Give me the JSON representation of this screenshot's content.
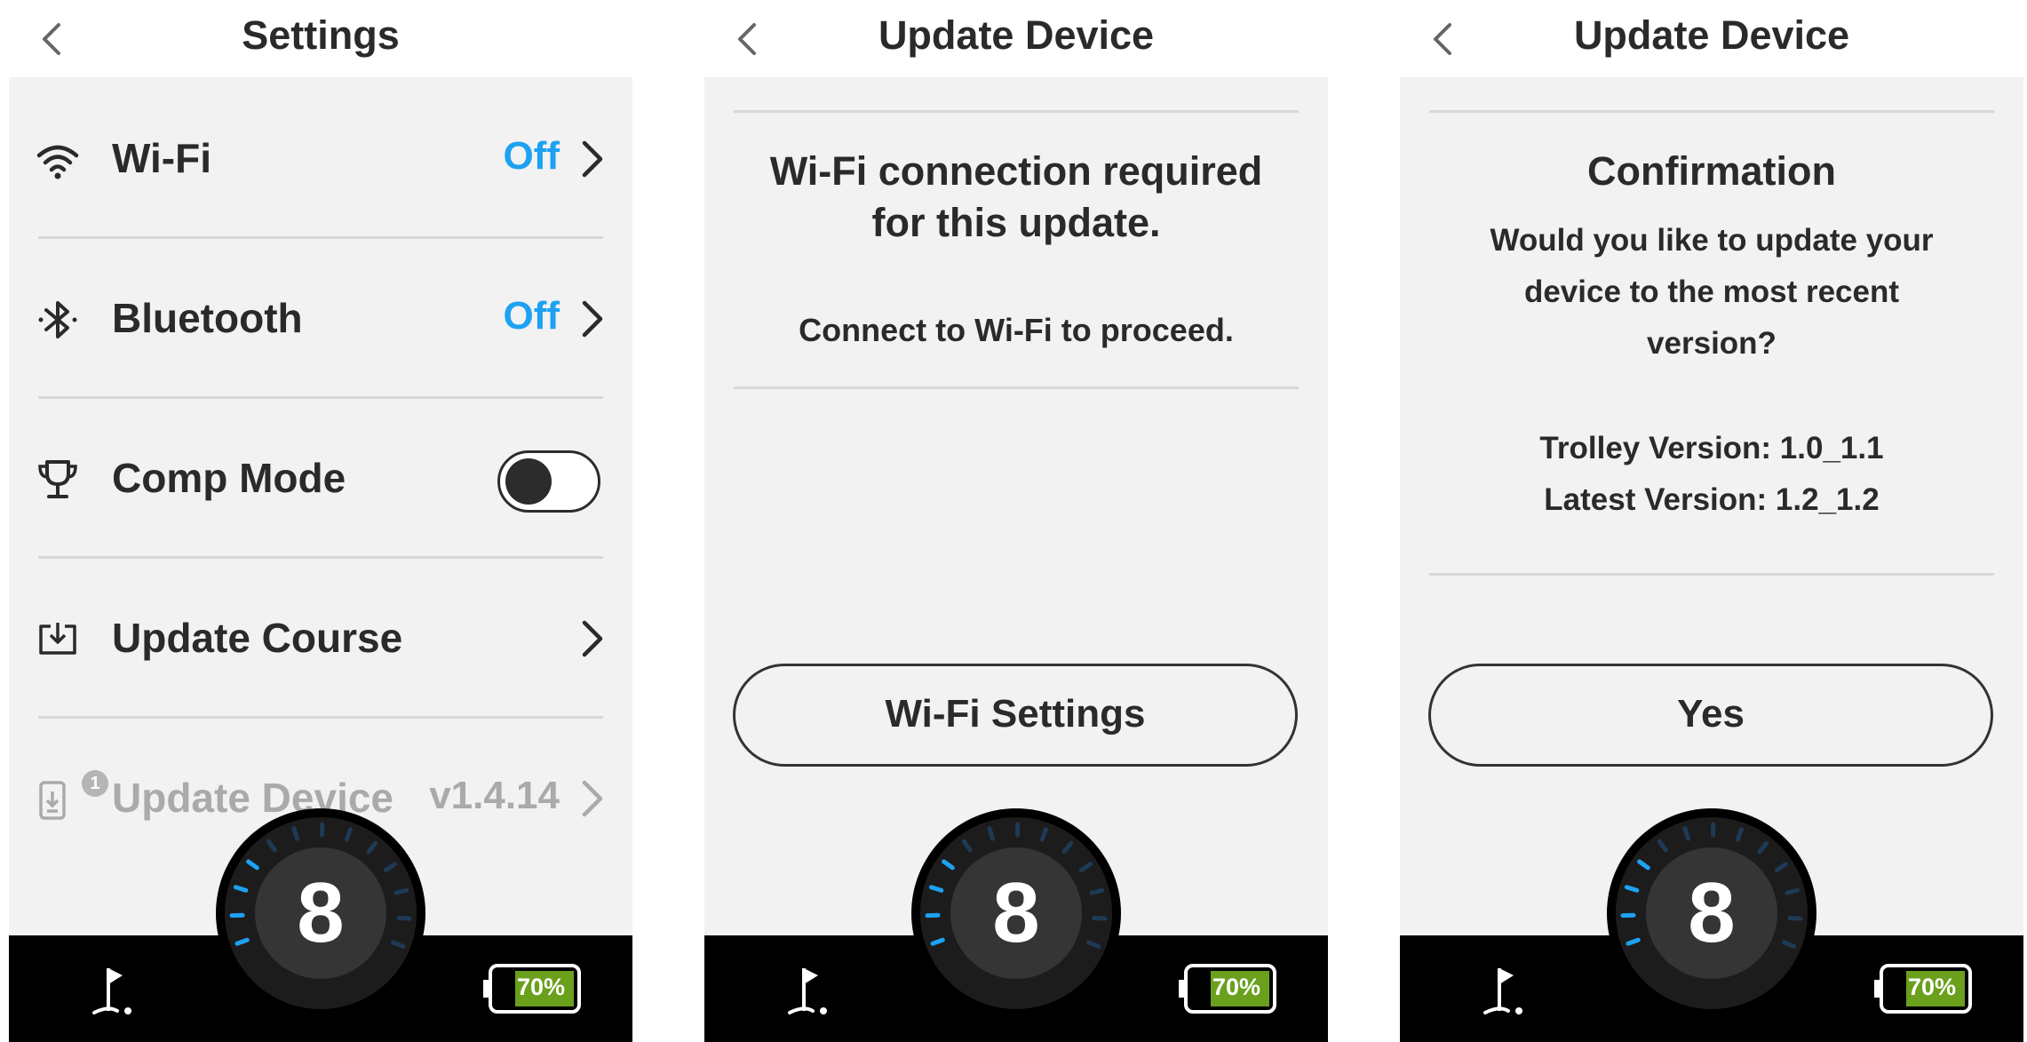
{
  "screens": [
    {
      "title": "Settings",
      "rows": [
        {
          "label": "Wi-Fi",
          "value": "Off",
          "icon": "wifi-icon"
        },
        {
          "label": "Bluetooth",
          "value": "Off",
          "icon": "bluetooth-icon"
        },
        {
          "label": "Comp Mode",
          "icon": "trophy-icon",
          "toggle": "off"
        },
        {
          "label": "Update Course",
          "icon": "download-box-icon"
        },
        {
          "label": "Update Device",
          "value": "v1.4.14",
          "icon": "device-update-icon",
          "badge": "1",
          "dimmed": true
        }
      ],
      "hole_number": "8",
      "battery": "70%"
    },
    {
      "title": "Update Device",
      "heading_line1": "Wi-Fi connection required",
      "heading_line2": "for this update.",
      "subtext": "Connect to Wi-Fi to proceed.",
      "button": "Wi-Fi Settings",
      "hole_number": "8",
      "battery": "70%"
    },
    {
      "title": "Update Device",
      "heading": "Confirmation",
      "question_line1": "Would you like to update your",
      "question_line2": "device to the most recent",
      "question_line3": "version?",
      "trolley_version": "Trolley Version: 1.0_1.1",
      "latest_version": "Latest Version: 1.2_1.2",
      "button": "Yes",
      "hole_number": "8",
      "battery": "70%"
    }
  ],
  "colors": {
    "accent": "#1da1f2",
    "battery_fill": "#6aa01c",
    "panel": "#f2f2f2",
    "footer": "#000000"
  }
}
